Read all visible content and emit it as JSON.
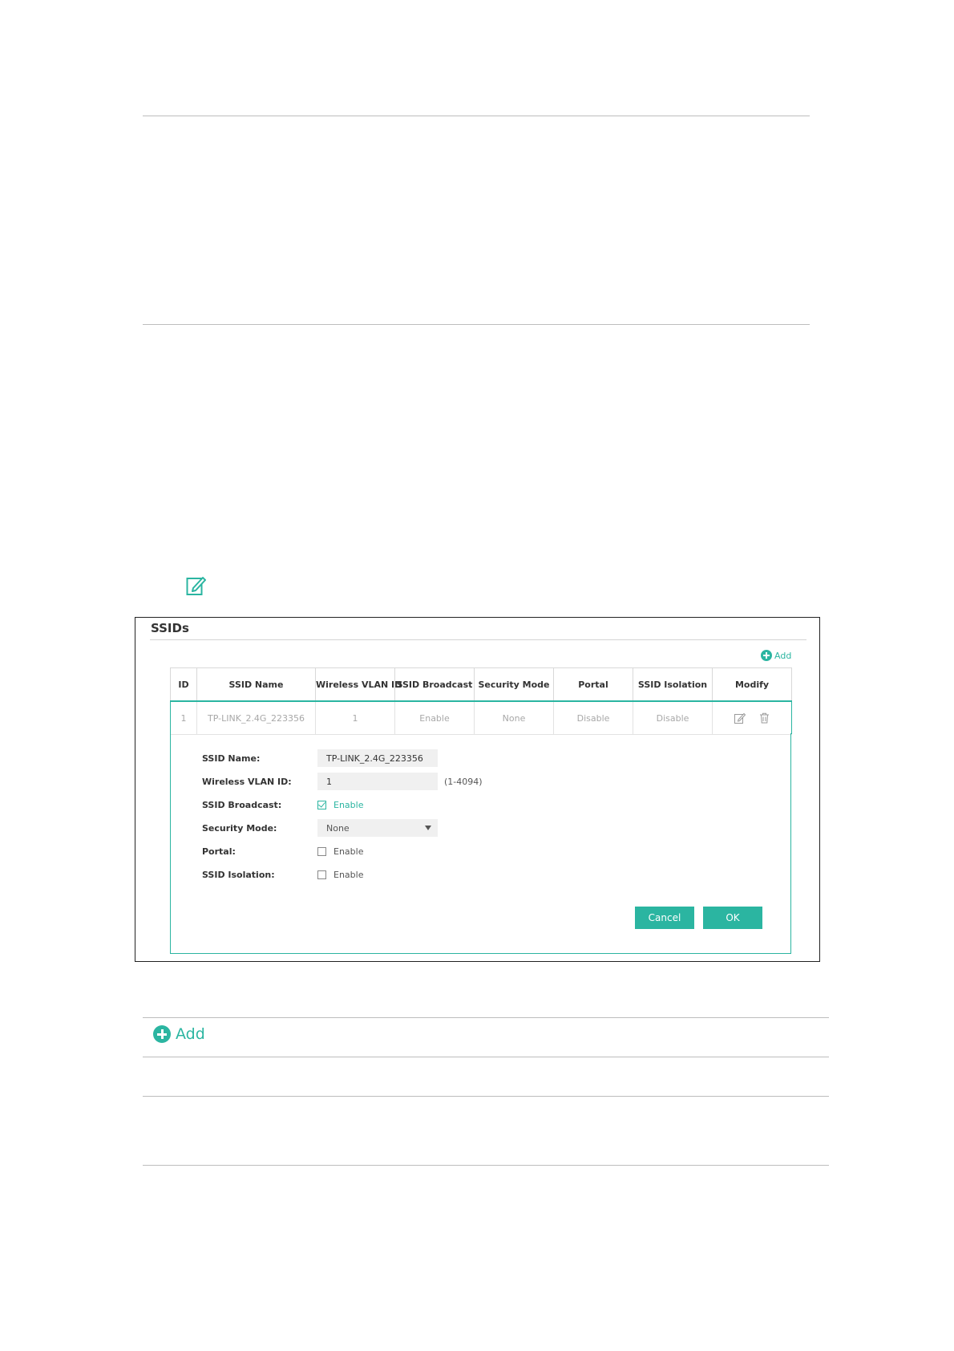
{
  "panel": {
    "title": "SSIDs",
    "add_label": "Add"
  },
  "table": {
    "headers": [
      "ID",
      "SSID Name",
      "Wireless VLAN ID",
      "SSID Broadcast",
      "Security Mode",
      "Portal",
      "SSID Isolation",
      "Modify"
    ],
    "row": {
      "id": "1",
      "ssid_name": "TP-LINK_2.4G_223356",
      "vlan_id": "1",
      "broadcast": "Enable",
      "security_mode": "None",
      "portal": "Disable",
      "isolation": "Disable"
    }
  },
  "form": {
    "ssid_name_label": "SSID Name:",
    "ssid_name_value": "TP-LINK_2.4G_223356",
    "vlan_label": "Wireless VLAN ID:",
    "vlan_value": "1",
    "vlan_hint": "(1-4094)",
    "broadcast_label": "SSID Broadcast:",
    "broadcast_option": "Enable",
    "broadcast_checked": true,
    "security_label": "Security Mode:",
    "security_value": "None",
    "portal_label": "Portal:",
    "portal_option": "Enable",
    "portal_checked": false,
    "isolation_label": "SSID Isolation:",
    "isolation_option": "Enable",
    "isolation_checked": false,
    "cancel_label": "Cancel",
    "ok_label": "OK"
  },
  "below": {
    "add_label": "Add"
  },
  "colors": {
    "accent": "#2bb5a1"
  }
}
